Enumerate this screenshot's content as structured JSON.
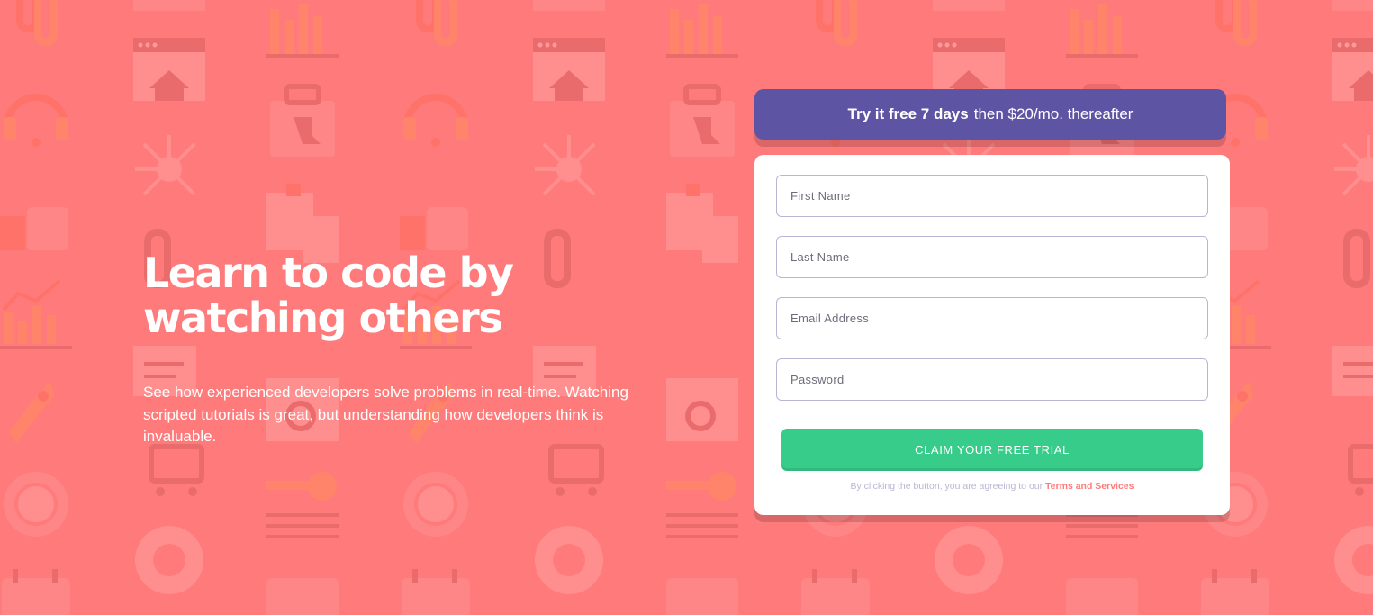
{
  "hero": {
    "title": "Learn to code by watching others",
    "description": "See how experienced developers solve problems in real-time. Watching scripted tutorials is great, but understanding how developers think is invaluable."
  },
  "promo": {
    "highlight": "Try it free 7 days",
    "rest": "then $20/mo. thereafter"
  },
  "form": {
    "first_name_placeholder": "First Name",
    "last_name_placeholder": "Last Name",
    "email_placeholder": "Email Address",
    "password_placeholder": "Password",
    "submit_label": "CLAIM YOUR FREE TRIAL",
    "terms_prefix": "By clicking the button, you are agreeing to our",
    "terms_link": "Terms and Services"
  },
  "colors": {
    "background": "#ff7a7a",
    "promo_banner": "#5e54a4",
    "cta_button": "#38cc8b",
    "terms_link": "#ff7a7a",
    "card": "#ffffff"
  },
  "background_icons": [
    "chain-link-icon",
    "bar-chart-icon",
    "browser-home-icon",
    "toolbox-icon",
    "headset-icon",
    "network-icon",
    "thumbs-up-icon",
    "line-chart-icon",
    "rocket-icon",
    "pencil-note-icon",
    "magnifier-window-icon",
    "cart-gear-icon",
    "key-icon",
    "globe-gear-icon",
    "lifebuoy-icon",
    "calendar-icon"
  ]
}
